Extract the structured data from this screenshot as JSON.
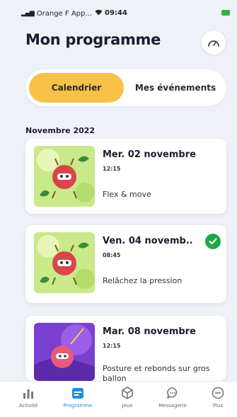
{
  "status_bar": {
    "carrier": "Orange F App...",
    "time": "09:44"
  },
  "header": {
    "title": "Mon programme",
    "settings_icon": "speedometer-icon"
  },
  "tabs": {
    "active": "Calendrier",
    "inactive": "Mes événements"
  },
  "month_label": "Novembre 2022",
  "events": [
    {
      "date": "Mer. 02 novembre",
      "time": "12:15",
      "name": "Flex & move",
      "completed": false,
      "thumb": "green"
    },
    {
      "date": "Ven. 04 novemb..",
      "time": "08:45",
      "name": "Relâchez la pression",
      "completed": true,
      "thumb": "green"
    },
    {
      "date": "Mar. 08 novembre",
      "time": "12:15",
      "name": "Posture et rebonds sur gros ballon",
      "completed": false,
      "thumb": "purple"
    }
  ],
  "nav": [
    {
      "label": "Activité",
      "icon": "activity-icon",
      "active": false
    },
    {
      "label": "Programme",
      "icon": "calendar-icon",
      "active": true
    },
    {
      "label": "Jeux",
      "icon": "cube-icon",
      "active": false
    },
    {
      "label": "Messagerie",
      "icon": "chat-icon",
      "active": false
    },
    {
      "label": "Plus",
      "icon": "more-icon",
      "active": false
    }
  ],
  "colors": {
    "accent_yellow": "#f8c147",
    "success_green": "#1fa84a",
    "nav_active_blue": "#1a8fd8",
    "background": "#eef2f8"
  }
}
